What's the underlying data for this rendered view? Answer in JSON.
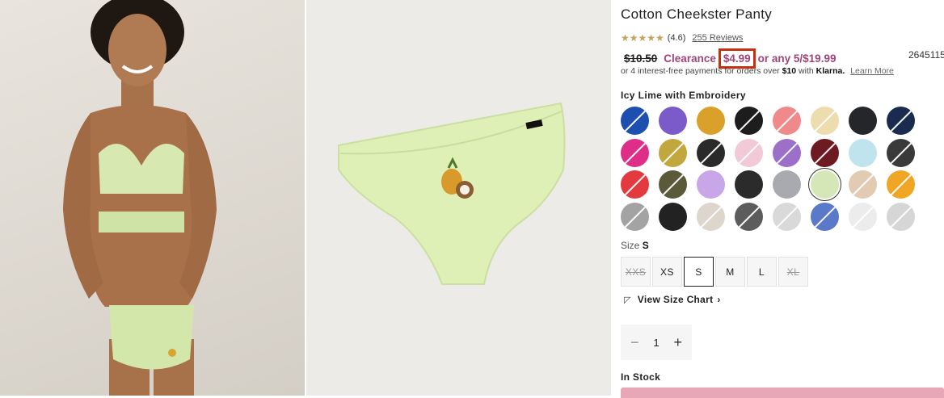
{
  "product": {
    "title": "Cotton Cheekster Panty",
    "rating": "(4.6)",
    "reviews": "255 Reviews",
    "old_price": "$10.50",
    "clearance": "Clearance",
    "sale_price": "$4.99",
    "multi_offer": "or any 5/$19.99",
    "sku": "2645115",
    "klarna_prefix": "or 4 interest-free payments for orders over",
    "klarna_amount": "$10",
    "klarna_with": "with",
    "klarna_brand": "Klarna.",
    "learn_more": "Learn More",
    "color_name": "Icy Lime with Embroidery"
  },
  "swatches": [
    {
      "color": "#1c4fb0",
      "na": true
    },
    {
      "color": "#7a5bc9",
      "na": false
    },
    {
      "color": "#d9a12a",
      "na": false
    },
    {
      "color": "#1d1d1d",
      "na": true
    },
    {
      "color": "#f08a8a",
      "na": true
    },
    {
      "color": "#eddcae",
      "na": true
    },
    {
      "color": "#242629",
      "na": false
    },
    {
      "color": "#1b2b4f",
      "na": true
    },
    {
      "color": "#df2e88",
      "na": true
    },
    {
      "color": "#c2a73e",
      "na": true
    },
    {
      "color": "#2a2a2a",
      "na": true
    },
    {
      "color": "#f2c9d6",
      "na": true
    },
    {
      "color": "#9c6fc8",
      "na": true
    },
    {
      "color": "#6e1a22",
      "na": true
    },
    {
      "color": "#bfe4ee",
      "na": false
    },
    {
      "color": "#3a3a3a",
      "na": true
    },
    {
      "color": "#e23a3f",
      "na": true
    },
    {
      "color": "#5a5a3a",
      "na": true
    },
    {
      "color": "#c9a6e8",
      "na": false
    },
    {
      "color": "#2b2b2b",
      "na": false
    },
    {
      "color": "#a9a9b0",
      "na": false
    },
    {
      "color": "#d5e7b6",
      "na": false,
      "selected": true
    },
    {
      "color": "#e2cbb3",
      "na": true
    },
    {
      "color": "#f0a524",
      "na": true
    },
    {
      "color": "#a3a3a3",
      "na": true
    },
    {
      "color": "#222222",
      "na": false
    },
    {
      "color": "#dcd6cc",
      "na": true
    },
    {
      "color": "#5c5c5c",
      "na": true
    },
    {
      "color": "#d9d9d9",
      "na": true
    },
    {
      "color": "#5a79c9",
      "na": true
    },
    {
      "color": "#ececec",
      "na": true
    },
    {
      "color": "#d6d6d6",
      "na": true
    }
  ],
  "size": {
    "label": "Size",
    "selected": "S",
    "options": [
      {
        "label": "XXS",
        "state": "na"
      },
      {
        "label": "XS",
        "state": ""
      },
      {
        "label": "S",
        "state": "on"
      },
      {
        "label": "M",
        "state": ""
      },
      {
        "label": "L",
        "state": ""
      },
      {
        "label": "XL",
        "state": "na"
      }
    ],
    "chart_link": "View Size Chart"
  },
  "quantity": {
    "minus": "−",
    "value": "1",
    "plus": "+"
  },
  "stock_status": "In Stock"
}
